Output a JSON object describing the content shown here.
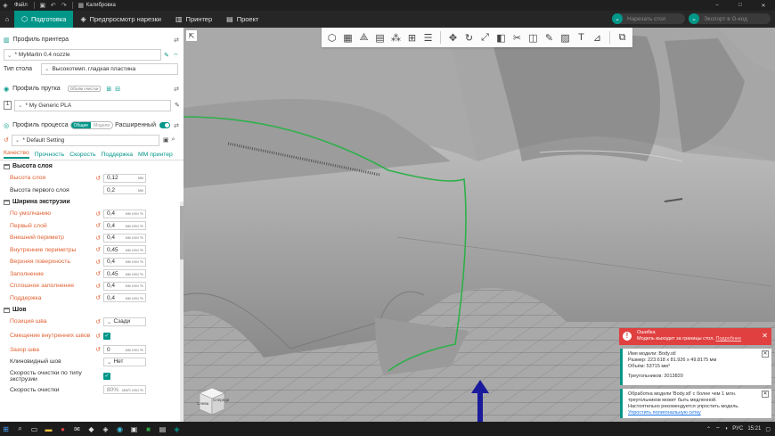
{
  "window": {
    "title": "Калибровка",
    "menu": "Файл"
  },
  "tabs": [
    {
      "label": "Подготовка",
      "icon": "cube-icon",
      "active": true
    },
    {
      "label": "Предпросмотр нарезки",
      "icon": "layers-icon",
      "active": false
    },
    {
      "label": "Принтер",
      "icon": "printer-icon",
      "active": false
    },
    {
      "label": "Проект",
      "icon": "folder-icon",
      "active": false
    }
  ],
  "actions": {
    "slice": "Нарезать стол",
    "export": "Экспорт в G-код"
  },
  "printer": {
    "section": "Профиль принтера",
    "value": "* MyMarlin 0.4 nozzle",
    "bed_label": "Тип стола",
    "bed_value": "Высокотемп. гладкая пластина"
  },
  "filament": {
    "section": "Профиль прутка",
    "flush": "Объём очистки",
    "slot": "1",
    "value": "* My Generic PLA"
  },
  "process": {
    "section": "Профиль процесса",
    "mode_on": "Общие",
    "mode_off": "Модели",
    "advanced": "Расширенный",
    "value": "* Default Setting"
  },
  "subtabs": [
    "Качество",
    "Прочность",
    "Скорость",
    "Поддержка",
    "ММ принтер"
  ],
  "groups": {
    "layer": {
      "title": "Высота слоя",
      "rows": [
        {
          "label": "Высота слоя",
          "value": "0,12",
          "unit": "мм",
          "changed": true
        },
        {
          "label": "Высота первого слоя",
          "value": "0,2",
          "unit": "мм",
          "changed": false
        }
      ]
    },
    "width": {
      "title": "Ширина экструзии",
      "rows": [
        {
          "label": "По умолчанию",
          "value": "0,4",
          "unit": "мм или %"
        },
        {
          "label": "Первый слой",
          "value": "0,4",
          "unit": "мм или %"
        },
        {
          "label": "Внешний периметр",
          "value": "0,4",
          "unit": "мм или %"
        },
        {
          "label": "Внутренние периметры",
          "value": "0,45",
          "unit": "мм или %"
        },
        {
          "label": "Верхняя поверхность",
          "value": "0,4",
          "unit": "мм или %"
        },
        {
          "label": "Заполнение",
          "value": "0,45",
          "unit": "мм или %"
        },
        {
          "label": "Сплошное заполнение",
          "value": "0,4",
          "unit": "мм или %"
        },
        {
          "label": "Поддержка",
          "value": "0,4",
          "unit": "мм или %"
        }
      ]
    },
    "seam": {
      "title": "Шов",
      "rows": [
        {
          "label": "Позиция шва",
          "value": "Сзади"
        },
        {
          "label": "Смещение внутренних швов"
        },
        {
          "label": "Зазор шва",
          "value": "0",
          "unit": "мм или %"
        },
        {
          "label": "Клиновидный шов",
          "value": "Нет"
        },
        {
          "label": "Скорость очистки по типу экструзии"
        },
        {
          "label": "Скорость очистки",
          "value": "80%",
          "unit": "мм/с или %"
        }
      ]
    }
  },
  "viewcube": {
    "front": "Спереди",
    "left": "Слева"
  },
  "notifications": {
    "error_title": "Ошибка",
    "error_text": "Модель выходит за границы стол.",
    "error_link": "Подробнее",
    "model_name": "Имя модели: Body.stl",
    "model_size": "Размер: 223.618 x 81.926 x 49.8175 мм",
    "model_volume": "Объём: 53715 мм³",
    "model_tris": "Треугольников: 2013820",
    "warn_1": "Обработка модели 'Body.stl' с более чем 1 млн.",
    "warn_2": "треугольников может быть медленной.",
    "warn_3": "Настоятельно рекомендуется упростить модель.",
    "warn_link": "Упростить полигональную сетку"
  },
  "tray": {
    "lang": "РУС",
    "time": "15:21"
  },
  "colors": {
    "accent": "#009688",
    "error": "#e04040",
    "changed": "#e06030"
  }
}
